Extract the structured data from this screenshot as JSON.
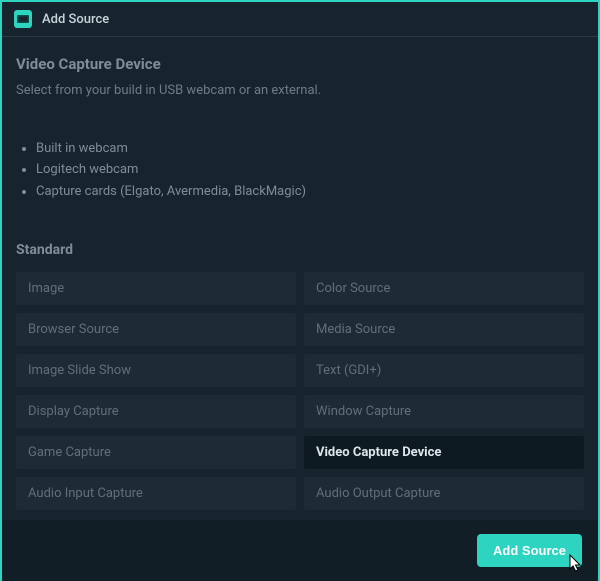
{
  "titlebar": {
    "title": "Add Source"
  },
  "section": {
    "title": "Video Capture Device",
    "description": "Select from your build in USB webcam or an external."
  },
  "bullets": [
    "Built in webcam",
    "Logitech webcam",
    "Capture cards (Elgato, Avermedia, BlackMagic)"
  ],
  "category": "Standard",
  "sources": [
    {
      "label": "Image",
      "selected": false
    },
    {
      "label": "Color Source",
      "selected": false
    },
    {
      "label": "Browser Source",
      "selected": false
    },
    {
      "label": "Media Source",
      "selected": false
    },
    {
      "label": "Image Slide Show",
      "selected": false
    },
    {
      "label": "Text (GDI+)",
      "selected": false
    },
    {
      "label": "Display Capture",
      "selected": false
    },
    {
      "label": "Window Capture",
      "selected": false
    },
    {
      "label": "Game Capture",
      "selected": false
    },
    {
      "label": "Video Capture Device",
      "selected": true
    },
    {
      "label": "Audio Input Capture",
      "selected": false
    },
    {
      "label": "Audio Output Capture",
      "selected": false
    }
  ],
  "footer": {
    "add_button": "Add Source"
  },
  "colors": {
    "accent": "#2dd4bf",
    "bg": "#17242d",
    "item_bg": "#1e2b34",
    "selected_bg": "#0d1a22"
  }
}
